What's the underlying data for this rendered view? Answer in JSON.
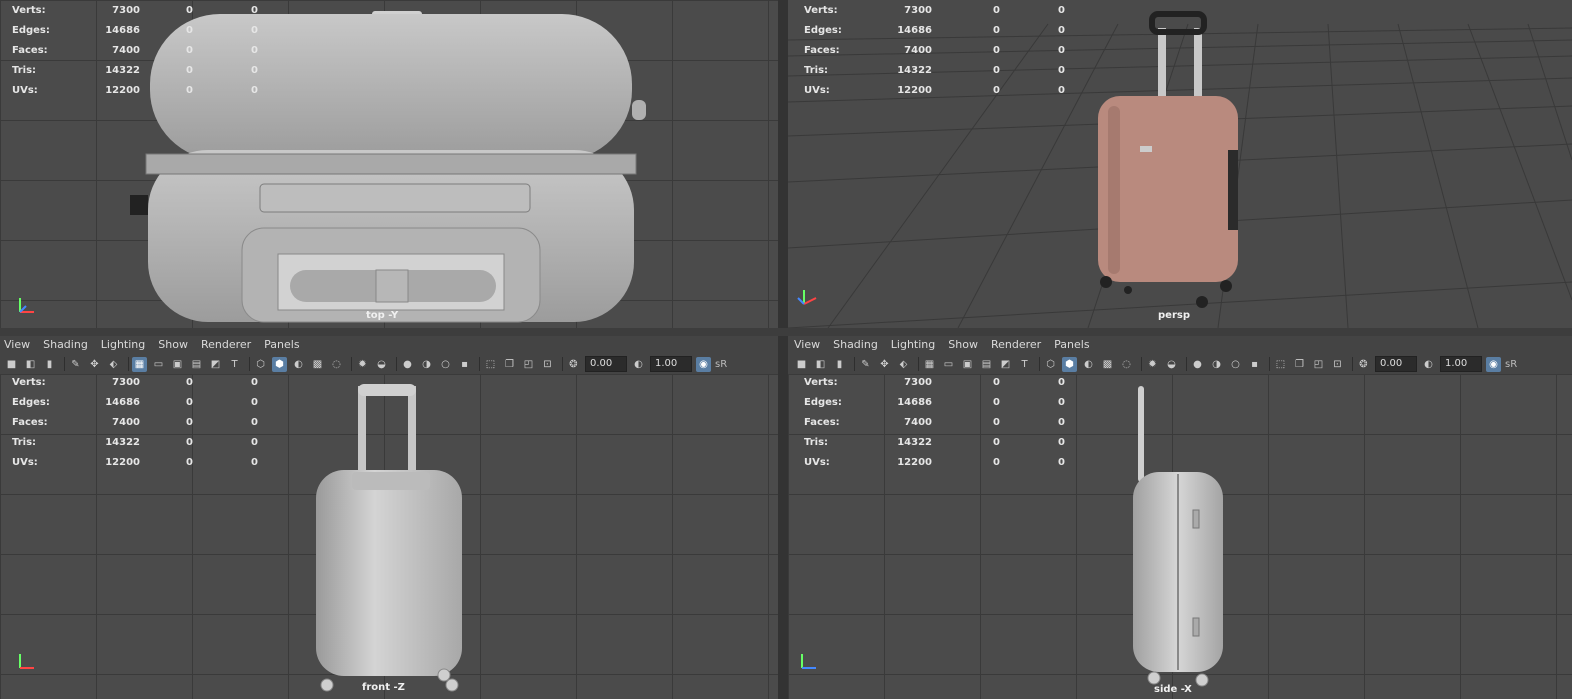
{
  "menu": [
    "View",
    "Shading",
    "Lighting",
    "Show",
    "Renderer",
    "Panels"
  ],
  "toolbar": {
    "field_a": "0.00",
    "field_b": "1.00",
    "tail": "sR"
  },
  "stats": [
    {
      "label": "Verts:",
      "v1": "7300",
      "v2": "0",
      "v3": "0"
    },
    {
      "label": "Edges:",
      "v1": "14686",
      "v2": "0",
      "v3": "0"
    },
    {
      "label": "Faces:",
      "v1": "7400",
      "v2": "0",
      "v3": "0"
    },
    {
      "label": "Tris:",
      "v1": "14322",
      "v2": "0",
      "v3": "0"
    },
    {
      "label": "UVs:",
      "v1": "12200",
      "v2": "0",
      "v3": "0"
    }
  ],
  "viewports": {
    "top": {
      "camera": "top -Y"
    },
    "persp": {
      "camera": "persp"
    },
    "front": {
      "camera": "front -Z"
    },
    "side": {
      "camera": "side -X"
    }
  },
  "colors": {
    "suitcase_persp": "#b98a7e",
    "suitcase_gray": "#b9b9b9",
    "highlight": "#5a7ea3"
  }
}
